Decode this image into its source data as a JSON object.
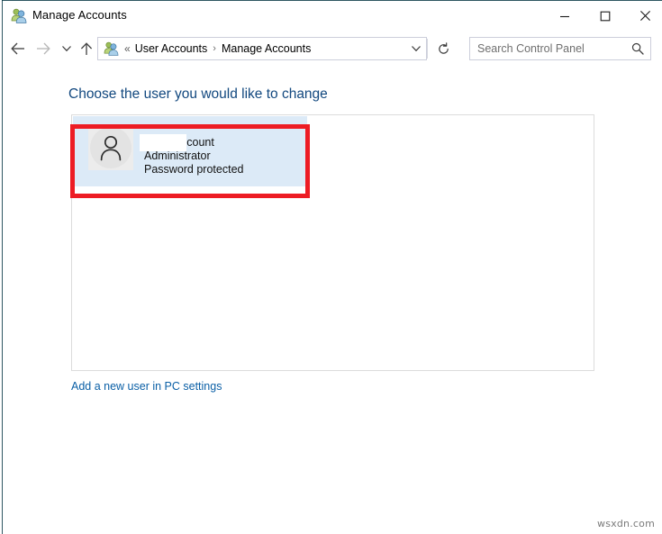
{
  "window": {
    "title": "Manage Accounts",
    "app_icon": "user-accounts-icon",
    "controls": {
      "minimize_label": "—",
      "maximize_label": "□",
      "close_label": "✕"
    }
  },
  "navbar": {
    "back_icon": "back-arrow-icon",
    "forward_icon": "forward-arrow-icon",
    "recent_icon": "chevron-down-icon",
    "up_icon": "up-arrow-icon",
    "address_icon": "user-accounts-icon",
    "overflow_chevrons": "«",
    "breadcrumb": [
      {
        "label": "User Accounts"
      },
      {
        "label": "Manage Accounts"
      }
    ],
    "breadcrumb_separator": "›",
    "dropdown_icon": "chevron-down-icon",
    "refresh_icon": "refresh-icon"
  },
  "search": {
    "placeholder": "Search Control Panel",
    "value": "",
    "icon": "search-icon"
  },
  "main": {
    "heading": "Choose the user you would like to change",
    "users": [
      {
        "avatar_icon": "person-silhouette-icon",
        "username_redacted": true,
        "account_type_line": "Local Account",
        "role_line": "Administrator",
        "password_line": "Password protected",
        "selected": true
      }
    ],
    "add_user_link": "Add a new user in PC settings"
  },
  "annotation": {
    "highlight_color": "#ed1c24",
    "target": "user-account-tile"
  },
  "watermark": "wsxdn.com"
}
